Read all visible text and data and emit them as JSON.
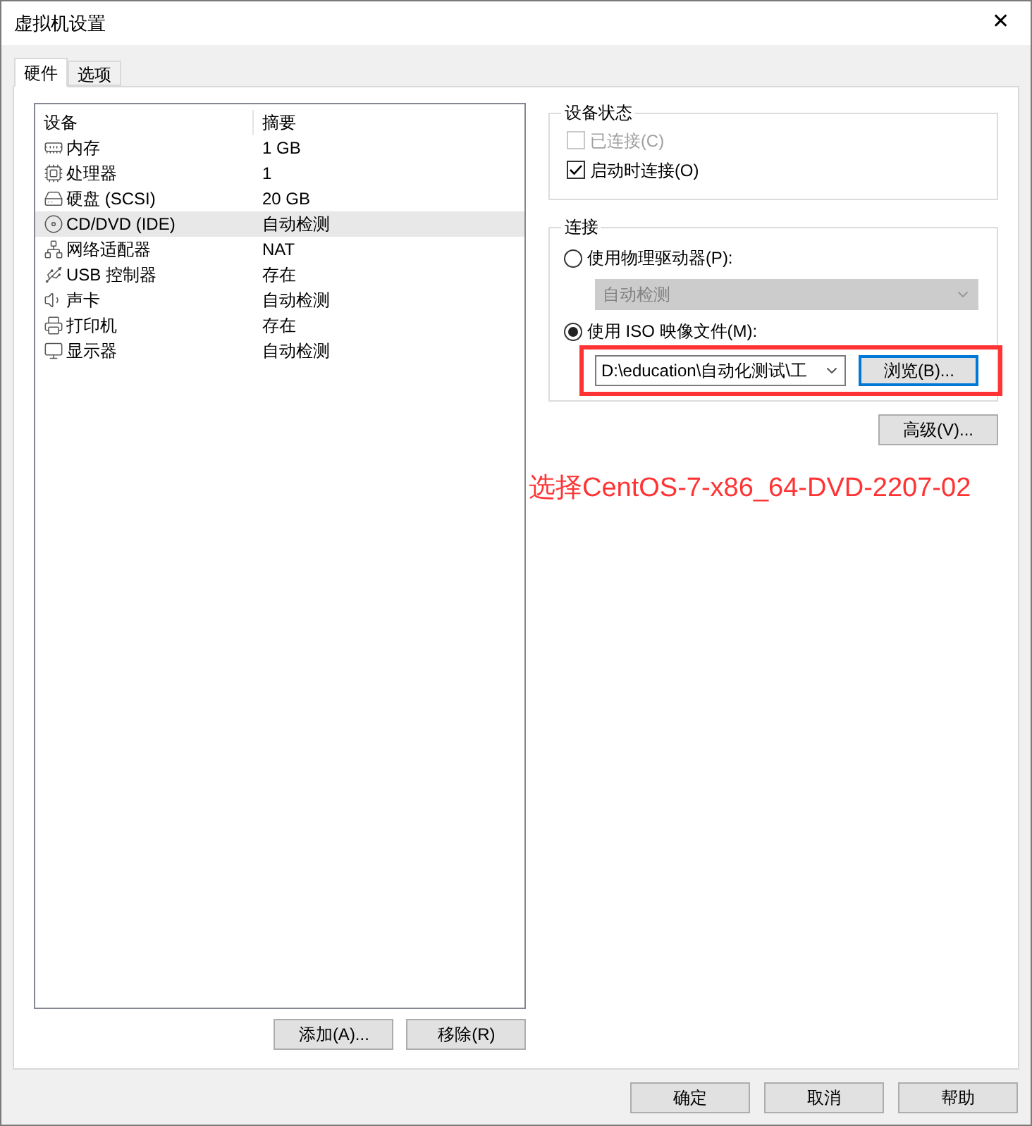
{
  "window": {
    "title": "虚拟机设置",
    "close": "✕"
  },
  "tabs": [
    {
      "label": "硬件",
      "selected": true
    },
    {
      "label": "选项",
      "selected": false
    }
  ],
  "devices": {
    "columns": [
      "设备",
      "摘要"
    ],
    "rows": [
      {
        "kind": "memory",
        "name": "内存",
        "summary": "1 GB",
        "selected": false
      },
      {
        "kind": "cpu",
        "name": "处理器",
        "summary": "1",
        "selected": false
      },
      {
        "kind": "disk",
        "name": "硬盘 (SCSI)",
        "summary": "20 GB",
        "selected": false
      },
      {
        "kind": "cd",
        "name": "CD/DVD (IDE)",
        "summary": "自动检测",
        "selected": true
      },
      {
        "kind": "network",
        "name": "网络适配器",
        "summary": "NAT",
        "selected": false
      },
      {
        "kind": "usb",
        "name": "USB 控制器",
        "summary": "存在",
        "selected": false
      },
      {
        "kind": "sound",
        "name": "声卡",
        "summary": "自动检测",
        "selected": false
      },
      {
        "kind": "printer",
        "name": "打印机",
        "summary": "存在",
        "selected": false
      },
      {
        "kind": "display",
        "name": "显示器",
        "summary": "自动检测",
        "selected": false
      }
    ],
    "buttons": [
      "添加(A)...",
      "移除(R)"
    ]
  },
  "device_status": {
    "title": "设备状态",
    "options": [
      {
        "label": "已连接(C)",
        "checked": false,
        "disabled": true
      },
      {
        "label": "启动时连接(O)",
        "checked": true,
        "disabled": false
      }
    ]
  },
  "connection": {
    "title": "连接",
    "physical": {
      "label": "使用物理驱动器(P):",
      "selected": false,
      "dropdown": "自动检测",
      "disabled": true
    },
    "iso": {
      "label": "使用 ISO 映像文件(M):",
      "selected": true,
      "path": "D:\\education\\自动化测试\\工",
      "browse": "浏览(B)..."
    }
  },
  "advanced_button": "高级(V)...",
  "annotation": {
    "text": "选择CentOS-7-x86_64-DVD-2207-02"
  },
  "footer_buttons": [
    "确定",
    "取消",
    "帮助"
  ]
}
